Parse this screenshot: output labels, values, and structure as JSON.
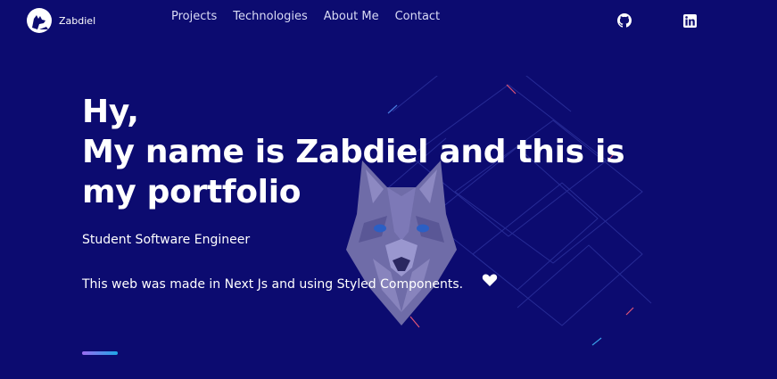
{
  "nav": {
    "brand_name": "Zabdiel",
    "menu": [
      {
        "label": "Projects"
      },
      {
        "label": "Technologies"
      },
      {
        "label": "About Me"
      },
      {
        "label": "Contact"
      }
    ],
    "social": [
      {
        "icon": "github-icon"
      },
      {
        "icon": "linkedin-icon"
      }
    ]
  },
  "hero": {
    "title_lines": [
      "Hy,",
      "My name is Zabdiel and this is",
      "my portfolio"
    ],
    "subtitle": "Student Software Engineer",
    "description": "This web was made in Next Js and using Styled Components.",
    "heart_icon": "heart-icon"
  },
  "colors": {
    "background": "#0c0b70",
    "text": "#ffffff",
    "accent_gradient_start": "#9b6cf0",
    "accent_gradient_end": "#1ea7e6"
  }
}
